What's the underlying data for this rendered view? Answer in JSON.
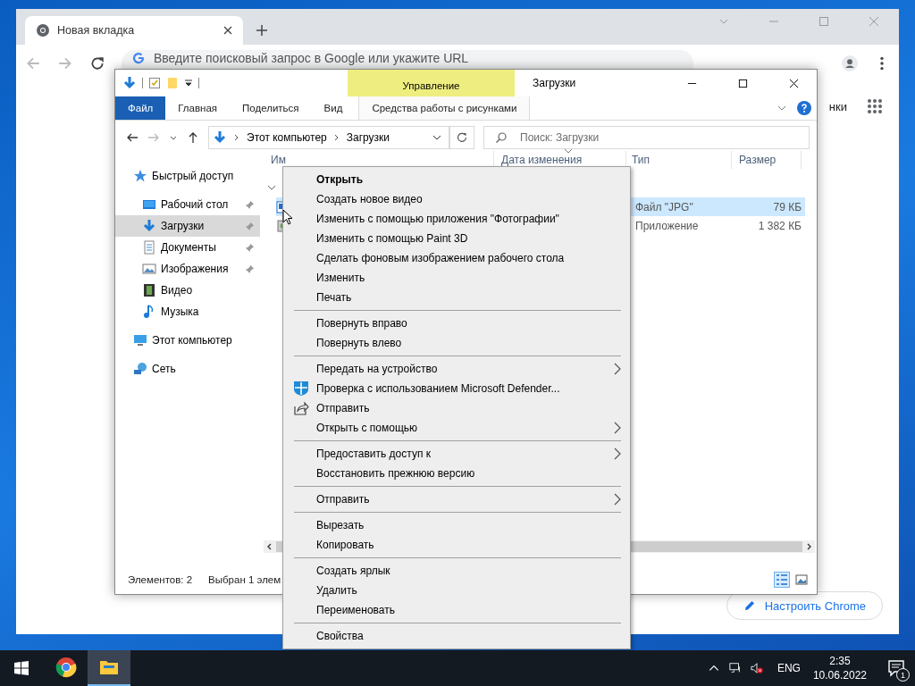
{
  "browser": {
    "tab_title": "Новая вкладка",
    "address_placeholder": "Введите поисковый запрос в Google или укажите URL",
    "link_text": "нки",
    "customize_button": "Настроить Chrome"
  },
  "explorer": {
    "title": "Загрузки",
    "context_group": "Управление",
    "ribbon_tabs": [
      {
        "label": "Файл",
        "selected": true
      },
      {
        "label": "Главная",
        "selected": false
      },
      {
        "label": "Поделиться",
        "selected": false
      },
      {
        "label": "Вид",
        "selected": false
      },
      {
        "label": "Средства работы с рисунками",
        "selected": false
      }
    ],
    "path": [
      "Этот компьютер",
      "Загрузки"
    ],
    "search": {
      "placeholder": "Поиск: Загрузки"
    },
    "nav": [
      {
        "label": "Быстрый доступ",
        "kind": "star",
        "selected": false,
        "pinned": false,
        "children": [
          {
            "label": "Рабочий стол",
            "kind": "desktop",
            "selected": false,
            "pinned": true
          },
          {
            "label": "Загрузки",
            "kind": "download",
            "selected": true,
            "pinned": true
          },
          {
            "label": "Документы",
            "kind": "document",
            "selected": false,
            "pinned": true
          },
          {
            "label": "Изображения",
            "kind": "pictures",
            "selected": false,
            "pinned": true
          },
          {
            "label": "Видео",
            "kind": "video",
            "selected": false,
            "pinned": false
          },
          {
            "label": "Музыка",
            "kind": "music",
            "selected": false,
            "pinned": false
          }
        ]
      },
      {
        "label": "Этот компьютер",
        "kind": "computer",
        "selected": false,
        "pinned": false
      },
      {
        "label": "Сеть",
        "kind": "network",
        "selected": false,
        "pinned": false
      }
    ],
    "columns": [
      "Им",
      "Дата изменения",
      "Тип",
      "Размер"
    ],
    "rows": [
      {
        "type": "Файл \"JPG\"",
        "size": "79 КБ",
        "kind": "image",
        "selected": true
      },
      {
        "type": "Приложение",
        "size": "1 382 КБ",
        "kind": "app",
        "selected": false
      }
    ],
    "status": [
      "Элементов: 2",
      "Выбран 1 элем"
    ]
  },
  "context_menu": [
    [
      {
        "label": "Открыть",
        "default": true,
        "submenu": false,
        "kind": "plain"
      },
      {
        "label": "Создать новое видео",
        "default": false,
        "submenu": false,
        "kind": "plain"
      },
      {
        "label": "Изменить с помощью приложения \"Фотографии\"",
        "default": false,
        "submenu": false,
        "kind": "plain"
      },
      {
        "label": "Изменить с помощью Paint 3D",
        "default": false,
        "submenu": false,
        "kind": "plain"
      },
      {
        "label": "Сделать фоновым изображением рабочего стола",
        "default": false,
        "submenu": false,
        "kind": "plain"
      },
      {
        "label": "Изменить",
        "default": false,
        "submenu": false,
        "kind": "plain"
      },
      {
        "label": "Печать",
        "default": false,
        "submenu": false,
        "kind": "plain"
      }
    ],
    [
      {
        "label": "Повернуть вправо",
        "default": false,
        "submenu": false,
        "kind": "plain"
      },
      {
        "label": "Повернуть влево",
        "default": false,
        "submenu": false,
        "kind": "plain"
      }
    ],
    [
      {
        "label": "Передать на устройство",
        "default": false,
        "submenu": true,
        "kind": "plain"
      },
      {
        "label": "Проверка с использованием Microsoft Defender...",
        "default": false,
        "submenu": false,
        "kind": "defender"
      },
      {
        "label": "Отправить",
        "default": false,
        "submenu": false,
        "kind": "share"
      },
      {
        "label": "Открыть с помощью",
        "default": false,
        "submenu": true,
        "kind": "plain"
      }
    ],
    [
      {
        "label": "Предоставить доступ к",
        "default": false,
        "submenu": true,
        "kind": "plain"
      },
      {
        "label": "Восстановить прежнюю версию",
        "default": false,
        "submenu": false,
        "kind": "plain"
      }
    ],
    [
      {
        "label": "Отправить",
        "default": false,
        "submenu": true,
        "kind": "plain"
      }
    ],
    [
      {
        "label": "Вырезать",
        "default": false,
        "submenu": false,
        "kind": "plain"
      },
      {
        "label": "Копировать",
        "default": false,
        "submenu": false,
        "kind": "plain"
      }
    ],
    [
      {
        "label": "Создать ярлык",
        "default": false,
        "submenu": false,
        "kind": "plain"
      },
      {
        "label": "Удалить",
        "default": false,
        "submenu": false,
        "kind": "plain"
      },
      {
        "label": "Переименовать",
        "default": false,
        "submenu": false,
        "kind": "plain"
      }
    ],
    [
      {
        "label": "Свойства",
        "default": false,
        "submenu": false,
        "kind": "plain"
      }
    ]
  ],
  "taskbar": {
    "apps": [
      {
        "kind": "chrome",
        "active": false
      },
      {
        "kind": "explorer",
        "active": true
      }
    ],
    "language": "ENG",
    "time": "2:35",
    "date": "10.06.2022",
    "notifications": "1"
  }
}
